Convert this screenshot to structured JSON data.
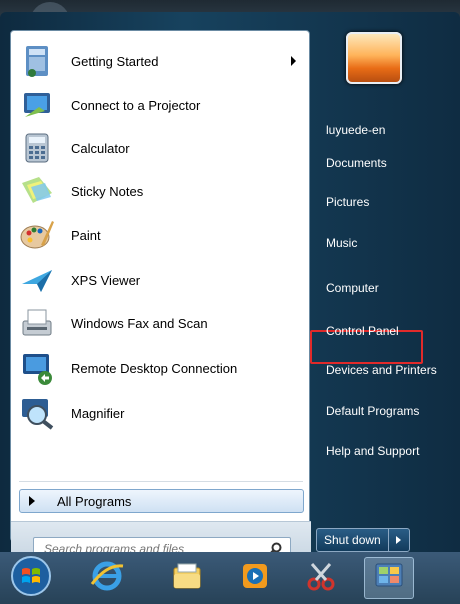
{
  "programs": [
    {
      "label": "Getting Started",
      "icon": "getting-started-icon",
      "has_submenu": true
    },
    {
      "label": "Connect to a Projector",
      "icon": "projector-icon",
      "has_submenu": false
    },
    {
      "label": "Calculator",
      "icon": "calculator-icon",
      "has_submenu": false
    },
    {
      "label": "Sticky Notes",
      "icon": "sticky-notes-icon",
      "has_submenu": false
    },
    {
      "label": "Paint",
      "icon": "paint-palette-icon",
      "has_submenu": false
    },
    {
      "label": "XPS Viewer",
      "icon": "xps-viewer-icon",
      "has_submenu": false
    },
    {
      "label": "Windows Fax and Scan",
      "icon": "fax-scanner-icon",
      "has_submenu": false
    },
    {
      "label": "Remote Desktop Connection",
      "icon": "remote-desktop-icon",
      "has_submenu": false
    },
    {
      "label": "Magnifier",
      "icon": "magnifier-icon",
      "has_submenu": false
    }
  ],
  "all_programs": {
    "label": "All Programs"
  },
  "search": {
    "placeholder": "Search programs and files"
  },
  "right_pane": {
    "items": [
      {
        "label": "luyuede-en"
      },
      {
        "label": "Documents"
      },
      {
        "label": "Pictures"
      },
      {
        "label": "Music"
      },
      {
        "label": "Computer"
      },
      {
        "label": "Control Panel",
        "highlighted": true
      },
      {
        "label": "Devices and Printers"
      },
      {
        "label": "Default Programs"
      },
      {
        "label": "Help and Support"
      }
    ]
  },
  "shutdown": {
    "label": "Shut down"
  },
  "taskbar": {
    "items": [
      {
        "name": "start-orb-icon"
      },
      {
        "name": "internet-explorer-icon"
      },
      {
        "name": "file-explorer-icon"
      },
      {
        "name": "media-player-icon"
      },
      {
        "name": "snipping-tool-icon"
      },
      {
        "name": "control-panel-taskbar-icon",
        "active": true
      }
    ]
  },
  "colors": {
    "highlight_border": "#e12a2a",
    "menu_dark": "#17425e"
  }
}
